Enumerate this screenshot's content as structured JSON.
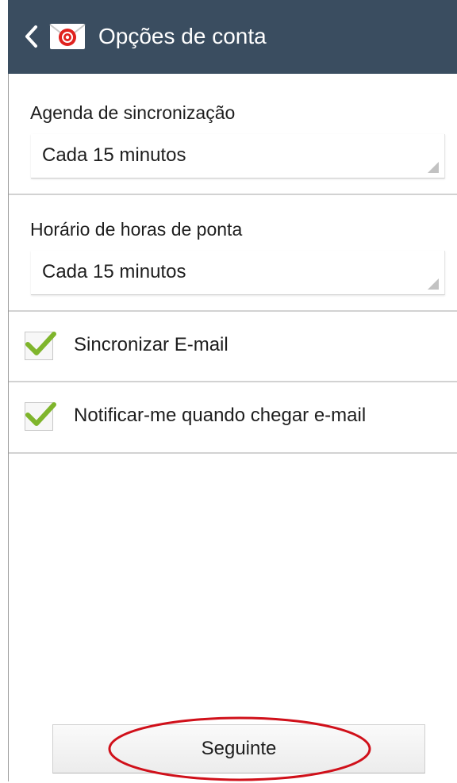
{
  "header": {
    "title": "Opções de conta",
    "background_color": "#3a4d60",
    "back_icon": "back-arrow-icon",
    "app_icon": "email-app-icon"
  },
  "sync_schedule": {
    "label": "Agenda de sincronização",
    "value": "Cada 15 minutos"
  },
  "peak_schedule": {
    "label": "Horário de horas de ponta",
    "value": "Cada 15 minutos"
  },
  "checkboxes": [
    {
      "label": "Sincronizar E-mail",
      "checked": true
    },
    {
      "label": "Notificar-me quando chegar e-mail",
      "checked": true
    }
  ],
  "footer": {
    "next_label": "Seguinte",
    "annotation_color": "#d0101a"
  },
  "colors": {
    "check_green": "#7fb52c",
    "app_icon_red": "#e0221f"
  }
}
